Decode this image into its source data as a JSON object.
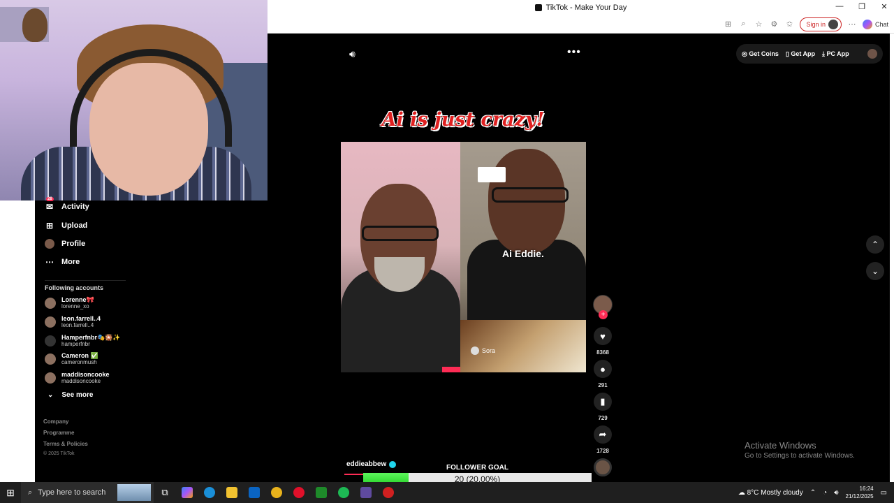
{
  "window": {
    "title": "TikTok - Make Your Day"
  },
  "browser": {
    "signin_label": "Sign in",
    "chat_label": "Chat"
  },
  "topbar": {
    "get_coins": "Get Coins",
    "get_app": "Get App",
    "pc_app": "PC App"
  },
  "sidebar": {
    "activity": {
      "label": "Activity",
      "badge": "28"
    },
    "upload": "Upload",
    "profile": "Profile",
    "more": "More",
    "following_title": "Following accounts",
    "accounts": [
      {
        "name": "Lorenne🎀",
        "handle": "lorenne_xo"
      },
      {
        "name": "leon.farrell..4",
        "handle": "leon.farrell..4"
      },
      {
        "name": "Hamperfnbr🎭🎇✨",
        "handle": "hamperfnbr"
      },
      {
        "name": "Cameron ✅",
        "handle": "cameronmush"
      },
      {
        "name": "maddisoncooke",
        "handle": "maddisoncooke"
      }
    ],
    "see_more": "See more",
    "footer": {
      "company": "Company",
      "programme": "Programme",
      "terms": "Terms & Policies",
      "copyright": "© 2025 TikTok"
    }
  },
  "video": {
    "title": "Ai is just crazy!",
    "caption": "Ai Eddie.",
    "watermark": "Sora",
    "author": "eddieabbew"
  },
  "actions": {
    "likes": "8368",
    "comments": "291",
    "saves": "729",
    "shares": "1728"
  },
  "goal": {
    "title": "FOLLOWER GOAL",
    "text": "20 (20.00%)",
    "progress": 0.2
  },
  "watermark": {
    "line1": "Activate Windows",
    "line2": "Go to Settings to activate Windows."
  },
  "taskbar": {
    "search_placeholder": "Type here to search",
    "weather": "8°C  Mostly cloudy",
    "time": "16:24",
    "date": "21/12/2025"
  }
}
